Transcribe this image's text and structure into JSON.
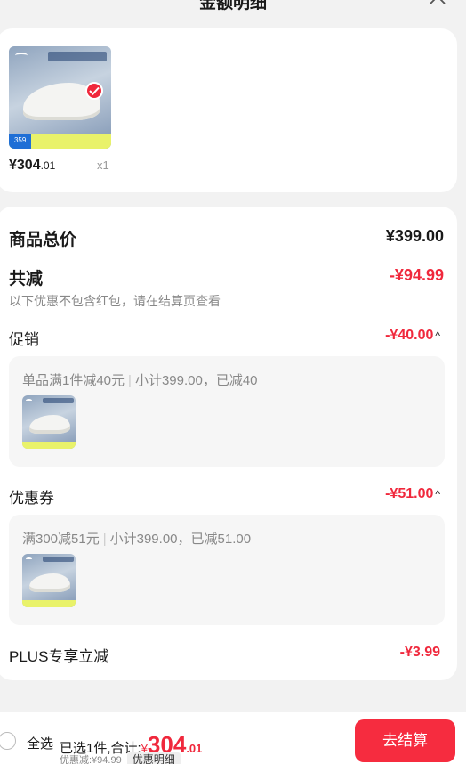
{
  "header": {
    "title": "金额明细"
  },
  "product": {
    "price_main": "¥304",
    "price_decimal": ".01",
    "quantity": "x1",
    "thumb_price_tag": "359"
  },
  "detail": {
    "total_label": "商品总价",
    "total_value": "¥399.00",
    "reduce_label": "共减",
    "reduce_value": "-¥94.99",
    "reduce_note": "以下优惠不包含红包，请在结算页查看",
    "promotion": {
      "label": "促销",
      "value": "-¥40.00",
      "rule": "单品满1件减40元",
      "summary": "小计399.00，已减40"
    },
    "coupon": {
      "label": "优惠券",
      "value": "-¥51.00",
      "rule": "满300减51元",
      "summary": "小计399.00，已减51.00"
    },
    "plus": {
      "label": "PLUS专享立减",
      "value": "-¥3.99"
    }
  },
  "bottom": {
    "select_all": "全选",
    "selected_prefix": "已选1件,合计:",
    "currency": "¥",
    "total_big": "304",
    "total_decimal": ".01",
    "discount_note": "优惠减:¥94.99",
    "discount_detail": "优惠明细",
    "checkout": "去结算"
  },
  "colors": {
    "accent": "#f0283c",
    "button": "#f62c3f"
  }
}
